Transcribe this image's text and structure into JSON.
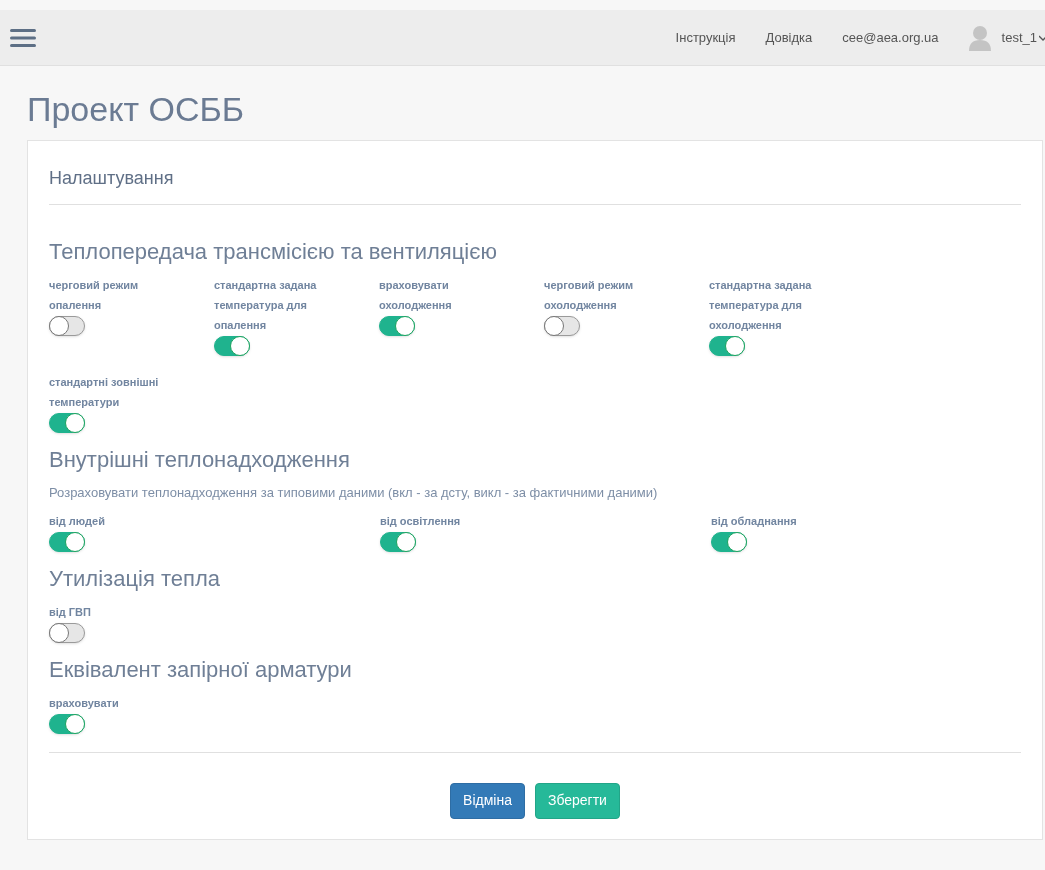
{
  "navbar": {
    "links": [
      "Інструкція",
      "Довідка",
      "cee@aea.org.ua"
    ],
    "user": "test_1"
  },
  "page_title": "Проект ОСББ",
  "card": {
    "title": "Налаштування",
    "sections": [
      {
        "title": "Теплопередача трансмісією та вентиляцією",
        "kind": "compact",
        "toggles": [
          {
            "label": "черговий режим опалення",
            "on": false
          },
          {
            "label": "стандартна задана температура для опалення",
            "on": true
          },
          {
            "label": "враховувати охолодження",
            "on": true
          },
          {
            "label": "черговий режим охолодження",
            "on": false
          },
          {
            "label": "стандартна задана температура для охолодження",
            "on": true
          },
          {
            "label": "стандартні зовнішні температури",
            "on": true
          }
        ]
      },
      {
        "title": "Внутрішні теплонадходження",
        "description": "Розраховувати теплонадходження за типовими даними (вкл - за дсту, викл - за фактичними даними)",
        "kind": "wide",
        "toggles": [
          {
            "label": "від людей",
            "on": true
          },
          {
            "label": "від освітлення",
            "on": true
          },
          {
            "label": "від обладнання",
            "on": true
          }
        ]
      },
      {
        "title": "Утилізація тепла",
        "kind": "wide",
        "toggles": [
          {
            "label": "від ГВП",
            "on": false
          }
        ]
      },
      {
        "title": "Еквівалент запірної арматури",
        "kind": "wide",
        "toggles": [
          {
            "label": "враховувати",
            "on": true
          }
        ]
      }
    ],
    "buttons": [
      {
        "label": "Відміна",
        "kind": "primary"
      },
      {
        "label": "Зберегти",
        "kind": "success"
      }
    ]
  }
}
